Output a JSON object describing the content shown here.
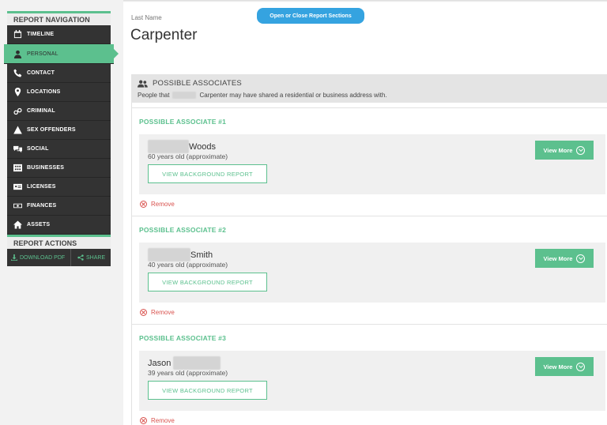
{
  "sidebar": {
    "nav_header": "REPORT NAVIGATION",
    "items": [
      {
        "label": "TIMELINE",
        "icon": "calendar-icon"
      },
      {
        "label": "PERSONAL",
        "icon": "person-icon"
      },
      {
        "label": "CONTACT",
        "icon": "phone-icon"
      },
      {
        "label": "LOCATIONS",
        "icon": "map-pin-icon"
      },
      {
        "label": "CRIMINAL",
        "icon": "handcuffs-icon"
      },
      {
        "label": "SEX OFFENDERS",
        "icon": "warning-icon"
      },
      {
        "label": "SOCIAL",
        "icon": "chat-icon"
      },
      {
        "label": "BUSINESSES",
        "icon": "building-icon"
      },
      {
        "label": "LICENSES",
        "icon": "id-card-icon"
      },
      {
        "label": "FINANCES",
        "icon": "money-icon"
      },
      {
        "label": "ASSETS",
        "icon": "home-icon"
      }
    ],
    "active_item": "PERSONAL",
    "actions_header": "REPORT ACTIONS",
    "download_label": "DOWNLOAD PDF",
    "share_label": "SHARE"
  },
  "header": {
    "last_name_label": "Last Name",
    "last_name_value": "Carpenter",
    "sections_button": "Open or Close Report Sections"
  },
  "associates": {
    "title": "POSSIBLE ASSOCIATES",
    "desc_before": "People that",
    "desc_after": "Carpenter may have shared a residential or business address with.",
    "cards": [
      {
        "title": "POSSIBLE ASSOCIATE #1",
        "name_visible": "Woods",
        "name_blur": "first",
        "age": "60 years old (approximate)",
        "report_button": "VIEW BACKGROUND REPORT",
        "view_more": "View More",
        "remove": "Remove"
      },
      {
        "title": "POSSIBLE ASSOCIATE #2",
        "name_visible": "Smith",
        "name_blur": "first",
        "age": "40 years old (approximate)",
        "report_button": "VIEW BACKGROUND REPORT",
        "view_more": "View More",
        "remove": "Remove"
      },
      {
        "title": "POSSIBLE ASSOCIATE #3",
        "name_visible": "Jason",
        "name_blur": "last",
        "age": "39 years old (approximate)",
        "report_button": "VIEW BACKGROUND REPORT",
        "view_more": "View More",
        "remove": "Remove"
      }
    ]
  },
  "colors": {
    "accent_green": "#5cc08e",
    "button_blue": "#35a3e0",
    "sidebar_dark": "#333333",
    "remove_red": "#d9534f"
  }
}
